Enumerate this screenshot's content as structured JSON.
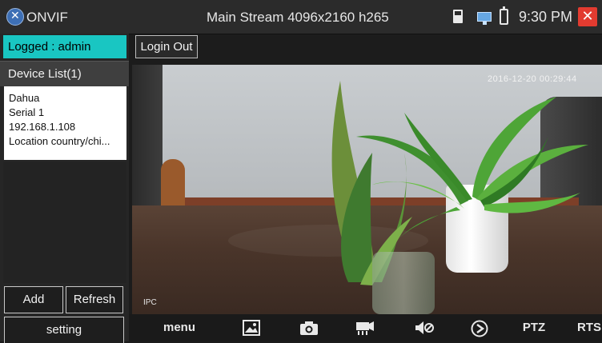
{
  "topbar": {
    "app_name": "ONVIF",
    "stream_title": "Main Stream 4096x2160 h265",
    "time": "9:30 PM"
  },
  "left_panel": {
    "logged_label": "Logged : admin",
    "device_list_header": "Device List(1)",
    "devices": [
      {
        "name": "Dahua",
        "serial": "Serial 1",
        "ip": "192.168.1.108",
        "location": "Location country/chi..."
      }
    ],
    "add_label": "Add",
    "refresh_label": "Refresh",
    "setting_label": "setting"
  },
  "login_out_label": "Login Out",
  "video": {
    "osd_timestamp": "2016-12-20 00:29:44",
    "osd_label": "IPC"
  },
  "toolbar": {
    "menu_label": "menu",
    "ptz_label": "PTZ",
    "rtsp_label": "RTSP"
  },
  "colors": {
    "accent": "#19c6c2",
    "close": "#e23b30",
    "topbar_bg": "#2b2b2b"
  },
  "icons": [
    "onvif-logo-icon",
    "sd-card-icon",
    "network-icon",
    "battery-icon",
    "close-icon",
    "gallery-icon",
    "camera-icon",
    "record-icon",
    "mute-icon",
    "play-icon"
  ]
}
